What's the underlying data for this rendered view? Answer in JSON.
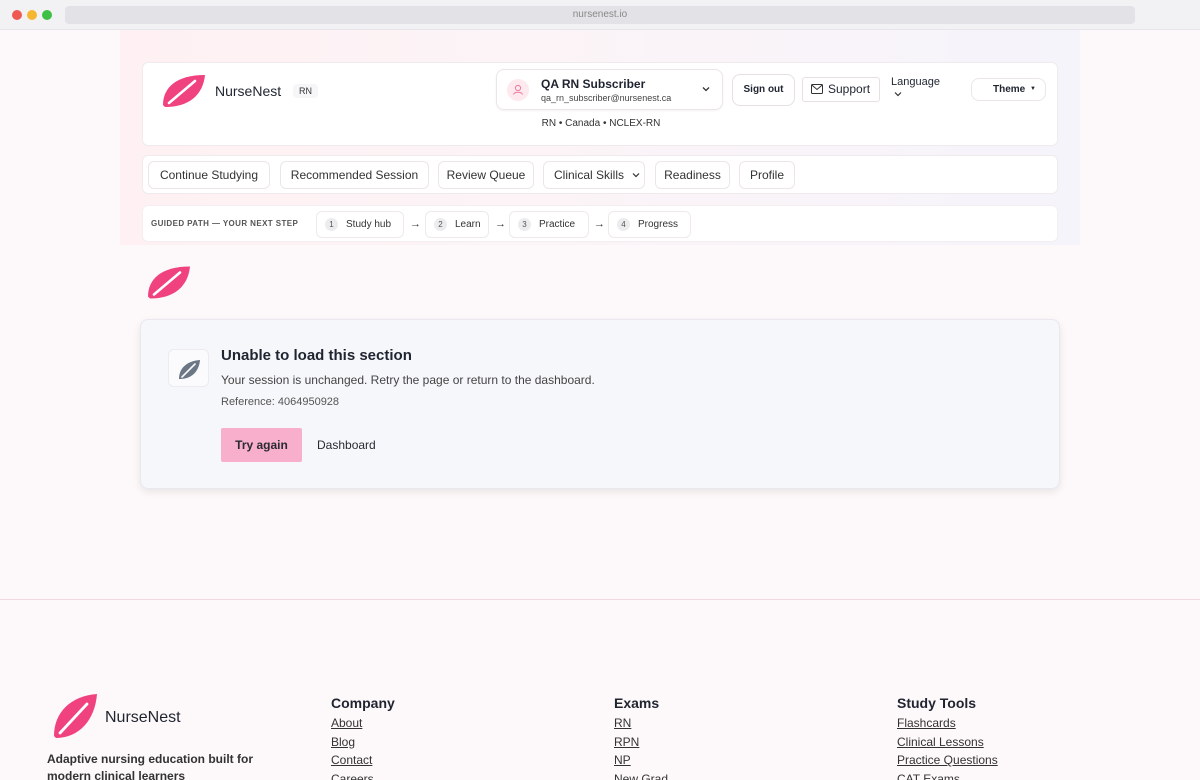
{
  "browser": {
    "url": "nursenest.io"
  },
  "header": {
    "brand": "NurseNest",
    "level_badge": "RN",
    "user": {
      "name": "QA RN Subscriber",
      "email": "qa_rn_subscriber@nursenest.ca"
    },
    "sign_out_label": "Sign out",
    "support_label": "Support",
    "language_label": "Language",
    "theme_label": "Theme",
    "context": "RN • Canada • NCLEX-RN"
  },
  "nav": {
    "items": [
      {
        "label": "Continue Studying"
      },
      {
        "label": "Recommended Session"
      },
      {
        "label": "Review Queue"
      },
      {
        "label": "Clinical Skills"
      },
      {
        "label": "Readiness"
      },
      {
        "label": "Profile"
      }
    ]
  },
  "guided_path": {
    "label": "GUIDED PATH — YOUR NEXT STEP",
    "steps": [
      {
        "num": "1",
        "label": "Study hub"
      },
      {
        "num": "2",
        "label": "Learn"
      },
      {
        "num": "3",
        "label": "Practice"
      },
      {
        "num": "4",
        "label": "Progress"
      }
    ],
    "arrow": "→"
  },
  "error": {
    "title": "Unable to load this section",
    "message": "Your session is unchanged. Retry the page or return to the dashboard.",
    "reference": "Reference: 4064950928",
    "retry_label": "Try again",
    "dashboard_label": "Dashboard"
  },
  "footer": {
    "brand": "NurseNest",
    "tagline": "Adaptive nursing education built for modern clinical learners",
    "columns": [
      {
        "title": "Company",
        "links": [
          "About",
          "Blog",
          "Contact",
          "Careers"
        ]
      },
      {
        "title": "Exams",
        "links": [
          "RN",
          "RPN",
          "NP",
          "New Grad"
        ]
      },
      {
        "title": "Study Tools",
        "links": [
          "Flashcards",
          "Clinical Lessons",
          "Practice Questions",
          "CAT Exams"
        ]
      }
    ]
  },
  "colors": {
    "brand_pink": "#f0427f",
    "button_pink": "#f8afcb",
    "leaf_gray": "#6b7785"
  }
}
